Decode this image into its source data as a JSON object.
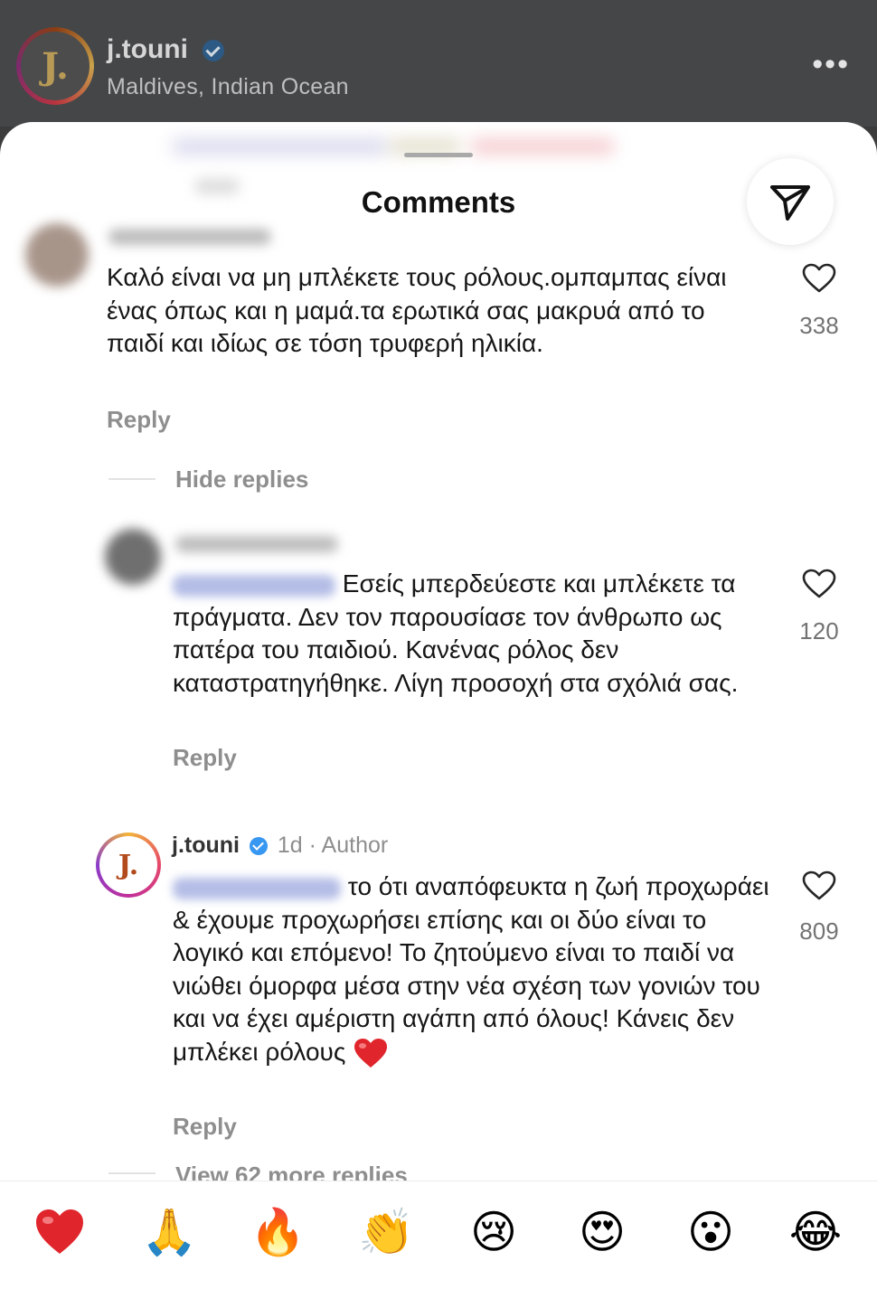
{
  "post": {
    "avatar_letter": "J.",
    "username": "j.touni",
    "location": "Maldives, Indian Ocean",
    "more_label": "•••"
  },
  "sheet": {
    "title": "Comments"
  },
  "comments": [
    {
      "text": "Καλό είναι να μη μπλέκετε τους ρόλους.ομπαμπας είναι ένας όπως και η μαμά.τα ερωτικά σας μακρυά από το παιδί και ιδίως σε τόση τρυφερή ηλικία.",
      "reply_label": "Reply",
      "likes": "338"
    }
  ],
  "thread": {
    "hide_label": "Hide replies",
    "view_more_label": "View 62 more replies"
  },
  "replies": [
    {
      "text": "Εσείς μπερδεύεστε και μπλέκετε τα πράγματα. Δεν τον παρουσίασε τον άνθρωπο ως πατέρα του παιδιού. Κανένας ρόλος δεν καταστρατηγήθηκε. Λίγη προσοχή στα σχόλιά σας.",
      "reply_label": "Reply",
      "likes": "120"
    },
    {
      "avatar_letter": "J.",
      "username": "j.touni",
      "time": "1d",
      "badge": "· Author",
      "text_line1": "το ότι αναπόφευκτα η ζωή",
      "text_rest": "προχωράει & έχουμε προχωρήσει επίσης και οι δύο είναι το λογικό και επόμενο! Το ζητούμενο είναι το παιδί να νιώθει όμορφα μέσα στην νέα σχέση των γονιών του και να έχει αμέριστη αγάπη από όλους! Κάνεις δεν μπλέκει ρόλους",
      "reply_label": "Reply",
      "likes": "809"
    }
  ],
  "emoji_bar": [
    {
      "name": "red-heart",
      "glyph": "❤"
    },
    {
      "name": "folded-hands",
      "glyph": "🙏"
    },
    {
      "name": "fire",
      "glyph": "🔥"
    },
    {
      "name": "clapping-hands",
      "glyph": "👏"
    },
    {
      "name": "crying-face",
      "glyph": "😢"
    },
    {
      "name": "heart-eyes",
      "glyph": "😍"
    },
    {
      "name": "surprised-face",
      "glyph": "😮"
    },
    {
      "name": "tears-of-joy",
      "glyph": "😂"
    }
  ],
  "colors": {
    "accent_blue": "#3897f0",
    "heart_red": "#e0262c",
    "muted_text": "#8e8e8e"
  }
}
